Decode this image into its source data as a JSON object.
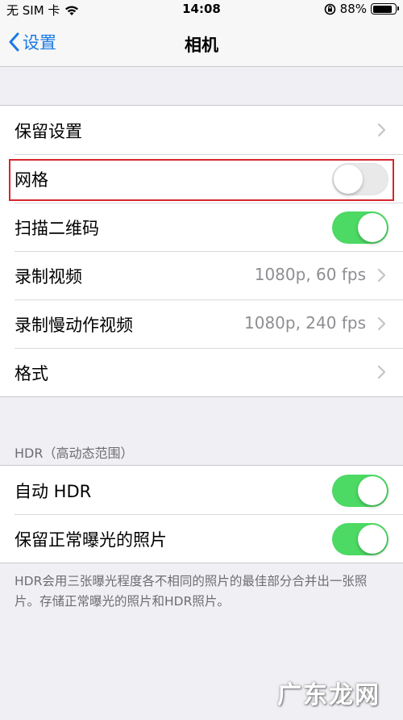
{
  "status_bar": {
    "carrier": "无 SIM 卡",
    "time": "14:08",
    "battery_percent": "88%",
    "battery_level": 0.88,
    "icons": [
      "wifi-icon",
      "orientation-lock-icon",
      "battery-icon"
    ]
  },
  "nav": {
    "back_label": "设置",
    "title": "相机"
  },
  "group1": {
    "rows": [
      {
        "label": "保留设置",
        "value": "",
        "control": "chevron"
      },
      {
        "label": "网格",
        "value": "",
        "control": "toggle",
        "toggle_on": false
      },
      {
        "label": "扫描二维码",
        "value": "",
        "control": "toggle",
        "toggle_on": true
      },
      {
        "label": "录制视频",
        "value": "1080p, 60 fps",
        "control": "chevron"
      },
      {
        "label": "录制慢动作视频",
        "value": "1080p, 240 fps",
        "control": "chevron"
      },
      {
        "label": "格式",
        "value": "",
        "control": "chevron"
      }
    ]
  },
  "hdr_section": {
    "header": "HDR（高动态范围）",
    "rows": [
      {
        "label": "自动 HDR",
        "control": "toggle",
        "toggle_on": true
      },
      {
        "label": "保留正常曝光的照片",
        "control": "toggle",
        "toggle_on": true
      }
    ],
    "footer": "HDR会用三张曝光程度各不相同的照片的最佳部分合并出一张照片。存储正常曝光的照片和HDR照片。"
  },
  "watermark": "广东龙网",
  "colors": {
    "accent": "#1a7ae6",
    "toggle_on": "#4cd964",
    "background": "#efeff4",
    "highlight": "#d7262e"
  }
}
